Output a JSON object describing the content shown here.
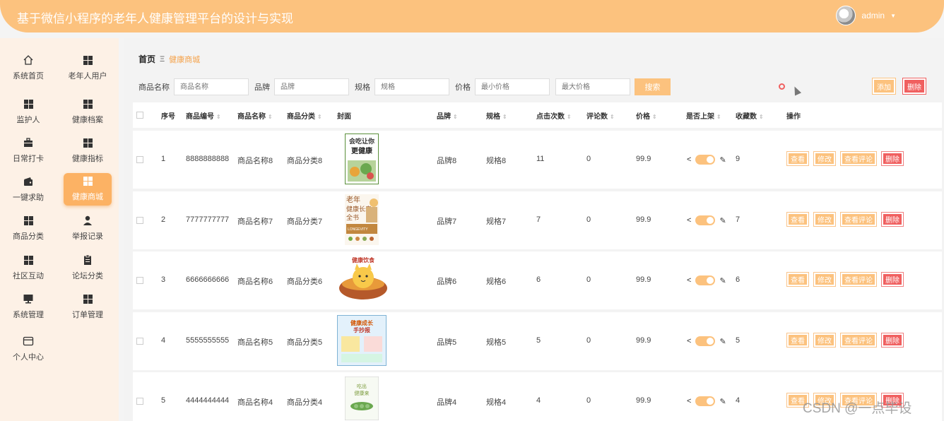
{
  "header": {
    "title": "基于微信小程序的老年人健康管理平台的设计与实现",
    "username": "admin"
  },
  "sidebar": {
    "items": [
      {
        "label": "系统首页",
        "icon": "home-icon"
      },
      {
        "label": "老年人用户",
        "icon": "grid-icon"
      },
      {
        "label": "监护人",
        "icon": "grid-icon"
      },
      {
        "label": "健康档案",
        "icon": "grid-icon"
      },
      {
        "label": "日常打卡",
        "icon": "briefcase-icon"
      },
      {
        "label": "健康指标",
        "icon": "grid-icon"
      },
      {
        "label": "一键求助",
        "icon": "wallet-icon"
      },
      {
        "label": "健康商城",
        "icon": "grid-icon",
        "active": true
      },
      {
        "label": "商品分类",
        "icon": "grid-icon"
      },
      {
        "label": "举报记录",
        "icon": "user-icon"
      },
      {
        "label": "社区互动",
        "icon": "grid-icon"
      },
      {
        "label": "论坛分类",
        "icon": "clipboard-icon"
      },
      {
        "label": "系统管理",
        "icon": "monitor-icon"
      },
      {
        "label": "订单管理",
        "icon": "grid-icon"
      },
      {
        "label": "个人中心",
        "icon": "card-icon"
      }
    ]
  },
  "breadcrumb": {
    "home": "首页",
    "separator": "Ξ",
    "current": "健康商城"
  },
  "filters": {
    "name_label": "商品名称",
    "name_placeholder": "商品名称",
    "brand_label": "品牌",
    "brand_placeholder": "品牌",
    "spec_label": "规格",
    "spec_placeholder": "规格",
    "price_label": "价格",
    "min_placeholder": "最小价格",
    "max_placeholder": "最大价格",
    "search_button": "搜索"
  },
  "toolbar": {
    "add": "添加",
    "delete": "删除"
  },
  "table": {
    "columns": {
      "index": "序号",
      "code": "商品编号",
      "name": "商品名称",
      "category": "商品分类",
      "cover": "封面",
      "brand": "品牌",
      "spec": "规格",
      "clicks": "点击次数",
      "comments": "评论数",
      "price": "价格",
      "on_shelf": "是否上架",
      "favorites": "收藏数",
      "ops": "操作"
    },
    "rows": [
      {
        "index": "1",
        "code": "8888888888",
        "name": "商品名称8",
        "category": "商品分类8",
        "brand": "品牌8",
        "spec": "规格8",
        "clicks": "11",
        "comments": "0",
        "price": "99.9",
        "on_shelf": true,
        "favorites": "9",
        "cover_text": [
          "会吃让你",
          "更健康"
        ]
      },
      {
        "index": "2",
        "code": "7777777777",
        "name": "商品名称7",
        "category": "商品分类7",
        "brand": "品牌7",
        "spec": "规格7",
        "clicks": "7",
        "comments": "0",
        "price": "99.9",
        "on_shelf": true,
        "favorites": "7",
        "cover_text": [
          "老年",
          "健康长寿",
          "全书",
          "LONGEVITY"
        ]
      },
      {
        "index": "3",
        "code": "6666666666",
        "name": "商品名称6",
        "category": "商品分类6",
        "brand": "品牌6",
        "spec": "规格6",
        "clicks": "6",
        "comments": "0",
        "price": "99.9",
        "on_shelf": true,
        "favorites": "6",
        "cover_text": [
          "健康饮食"
        ]
      },
      {
        "index": "4",
        "code": "5555555555",
        "name": "商品名称5",
        "category": "商品分类5",
        "brand": "品牌5",
        "spec": "规格5",
        "clicks": "5",
        "comments": "0",
        "price": "99.9",
        "on_shelf": true,
        "favorites": "5",
        "cover_text": [
          "健康成长",
          "手抄报"
        ]
      },
      {
        "index": "5",
        "code": "4444444444",
        "name": "商品名称4",
        "category": "商品分类4",
        "brand": "品牌4",
        "spec": "规格4",
        "clicks": "4",
        "comments": "0",
        "price": "99.9",
        "on_shelf": true,
        "favorites": "4",
        "cover_text": [
          "吃出",
          "健康来"
        ]
      }
    ],
    "ops": {
      "view": "查看",
      "edit": "修改",
      "view_comments": "查看评论",
      "delete": "删除"
    },
    "share_glyph": "<",
    "edit_glyph": "✎"
  },
  "watermark": "CSDN @一点毕设"
}
